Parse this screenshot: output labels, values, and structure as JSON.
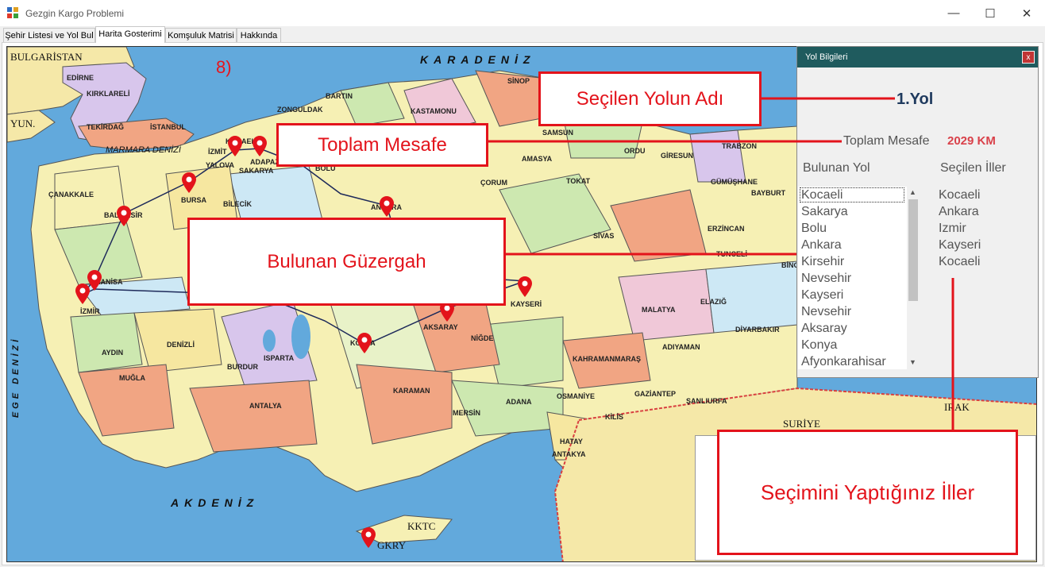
{
  "window": {
    "title": "Gezgin Kargo Problemi",
    "minimize": "—",
    "maximize": "☐",
    "close": "✕"
  },
  "tabs": [
    "Şehir Listesi ve Yol Bul",
    "Harita Gosterimi",
    "Komşuluk Matrisi",
    "Hakkında"
  ],
  "step_label": "8)",
  "map": {
    "seas": {
      "black_sea": "KARADENİZ",
      "mediterranean": "AKDENİZ",
      "aegean": "EGE DENİZİ",
      "marmara": "MARMARA DENİZİ"
    },
    "countries": {
      "bulgaria": "BULGARİSTAN",
      "greece": "YUN.",
      "syria": "SURİYE",
      "iraq": "IRAK",
      "kktc": "KKTC",
      "gkry": "GKRY"
    },
    "cities": [
      "EDİRNE",
      "KIRKLARELİ",
      "TEKİRDAĞ",
      "İSTANBUL",
      "ÇANAKKALE",
      "BALIKESİR",
      "BURSA",
      "YALOVA",
      "İZMİT",
      "KOCAELİ",
      "ADAPAZARI",
      "SAKARYA",
      "BOLU",
      "BARTIN",
      "ZONGULDAK",
      "KASTAMONU",
      "SİNOP",
      "SAMSUN",
      "ORDU",
      "GİRESUN",
      "TRABZON",
      "AMASYA",
      "TOKAT",
      "ÇORUM",
      "ANKARA",
      "BİLECİK",
      "MANİSA",
      "İZMİR",
      "AYDIN",
      "DENİZLİ",
      "MUĞLA",
      "BURDUR",
      "ISPARTA",
      "ANTALYA",
      "KONYA",
      "KARAMAN",
      "AKSARAY",
      "NİĞDE",
      "KAYSERİ",
      "SİVAS",
      "MALATYA",
      "ELAZIĞ",
      "ERZİNCAN",
      "TUNCELİ",
      "GÜMÜŞHANE",
      "BAYBURT",
      "BİNGÖL",
      "ADIYAMAN",
      "DİYARBAKIR",
      "KAHRAMANMARAŞ",
      "GAZİANTEP",
      "ŞANLIURFA",
      "OSMANİYE",
      "KİLİS",
      "ADANA",
      "MERSİN",
      "HATAY",
      "ANTAKYA"
    ]
  },
  "callouts": {
    "road_name": "Seçilen Yolun Adı",
    "total_distance": "Toplam Mesafe",
    "found_route": "Bulunan Güzergah",
    "selected_cities": "Seçimini Yaptığınız İller"
  },
  "panel": {
    "title": "Yol Bilgileri",
    "close": "x",
    "road_name": "1.Yol",
    "distance_label": "Toplam Mesafe",
    "distance_value": "2029 KM",
    "route_header": "Bulunan Yol",
    "selected_header": "Seçilen İller",
    "route": [
      "Kocaeli",
      "Sakarya",
      "Bolu",
      "Ankara",
      "Kirsehir",
      "Nevsehir",
      "Kayseri",
      "Nevsehir",
      "Aksaray",
      "Konya",
      "Afyonkarahisar"
    ],
    "selected": [
      "Kocaeli",
      "Ankara",
      "Izmir",
      "Kayseri",
      "Kocaeli"
    ]
  },
  "colors": {
    "accent_red": "#e3131b",
    "panel_header": "#1f5b5e",
    "sea": "#62a9dc",
    "route_line": "#1e2a5a"
  }
}
